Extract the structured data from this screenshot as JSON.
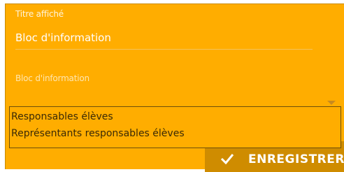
{
  "form": {
    "title_field": {
      "label": "Titre affiché",
      "value": "Bloc d'information"
    },
    "block_field": {
      "label": "Bloc d'information",
      "value": ""
    }
  },
  "dropdown": {
    "options": [
      "Responsables élèves",
      "Représentants responsables élèves"
    ]
  },
  "save_button": {
    "label": "ENREGISTRER",
    "icon": "check-icon"
  },
  "colors": {
    "panel": "#ffad00",
    "button": "#cf8c00",
    "text_light": "#ffffff"
  }
}
